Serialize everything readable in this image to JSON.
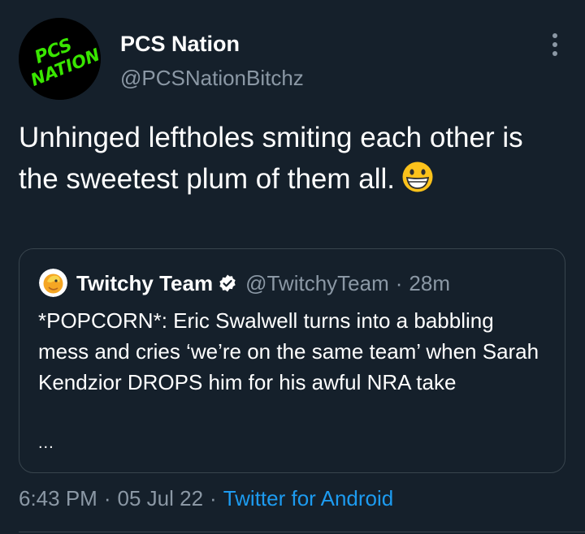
{
  "tweet": {
    "author_name": "PCS Nation",
    "author_handle": "@PCSNationBitchz",
    "avatar_logo_text": "PCS NATION",
    "text": "Unhinged leftholes smiting each other is the sweetest plum of them all.",
    "emoji_icon": "grinning-face-emoji",
    "more_icon": "vertical-ellipsis-icon"
  },
  "quote": {
    "author_name": "Twitchy Team",
    "author_handle": "@TwitchyTeam",
    "separator": "·",
    "time": "28m",
    "verified_icon": "verified-badge-icon",
    "text": "*POPCORN*: Eric Swalwell turns into a babbling mess and cries ‘we’re on the same team’ when Sarah Kendzior DROPS him for his awful NRA take",
    "truncation": "..."
  },
  "meta": {
    "time": "6:43 PM",
    "date": "05 Jul 22",
    "separator": "·",
    "source": "Twitter for Android"
  },
  "colors": {
    "background": "#15202b",
    "text": "#ffffff",
    "muted": "#8b98a5",
    "link": "#1d9bf0",
    "border": "#38444d",
    "logo_green": "#39e600"
  }
}
